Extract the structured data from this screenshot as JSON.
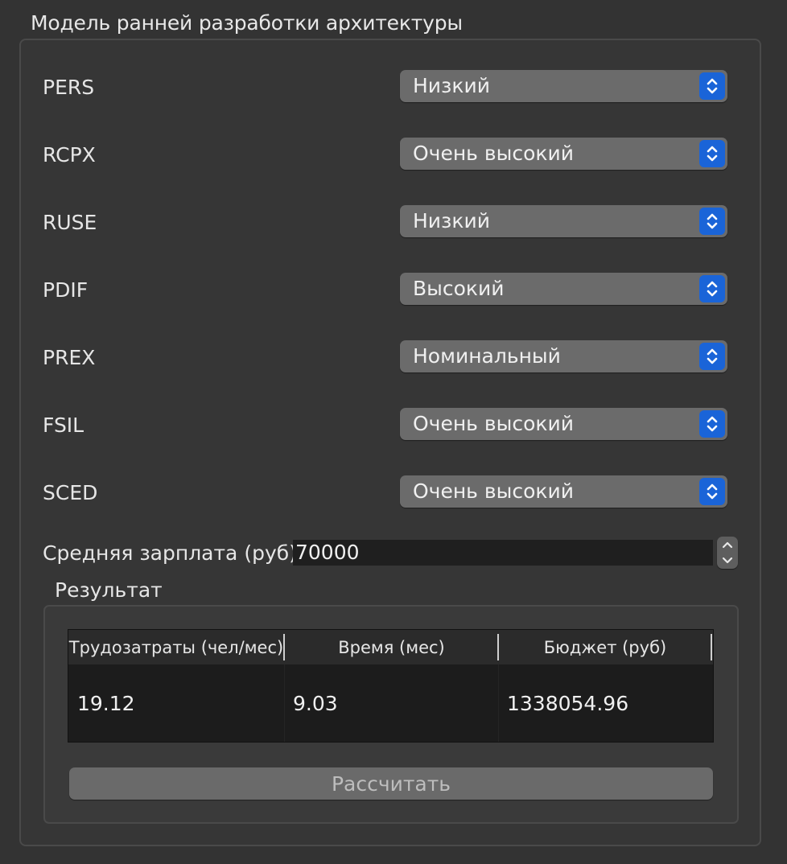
{
  "window": {
    "group_title": "Модель ранней разработки архитектуры"
  },
  "params": [
    {
      "label": "PERS",
      "value": "Низкий"
    },
    {
      "label": "RCPX",
      "value": "Очень высокий"
    },
    {
      "label": "RUSE",
      "value": "Низкий"
    },
    {
      "label": "PDIF",
      "value": "Высокий"
    },
    {
      "label": "PREX",
      "value": "Номинальный"
    },
    {
      "label": "FSIL",
      "value": "Очень высокий"
    },
    {
      "label": "SCED",
      "value": "Очень высокий"
    }
  ],
  "salary": {
    "label": "Средняя зарплата (руб)",
    "value": "70000"
  },
  "result": {
    "title": "Результат",
    "headers": [
      "Трудозатраты (чел/мес)",
      "Время (мес)",
      "Бюджет (руб)"
    ],
    "row": [
      "19.12",
      "9.03",
      "1338054.96"
    ]
  },
  "actions": {
    "calculate_label": "Рассчитать"
  },
  "icons": {
    "combo_arrow": "chevron-up-down-icon",
    "spin_up": "chevron-up-icon",
    "spin_down": "chevron-down-icon"
  },
  "colors": {
    "accent": "#1a64d8",
    "background": "#333333"
  }
}
